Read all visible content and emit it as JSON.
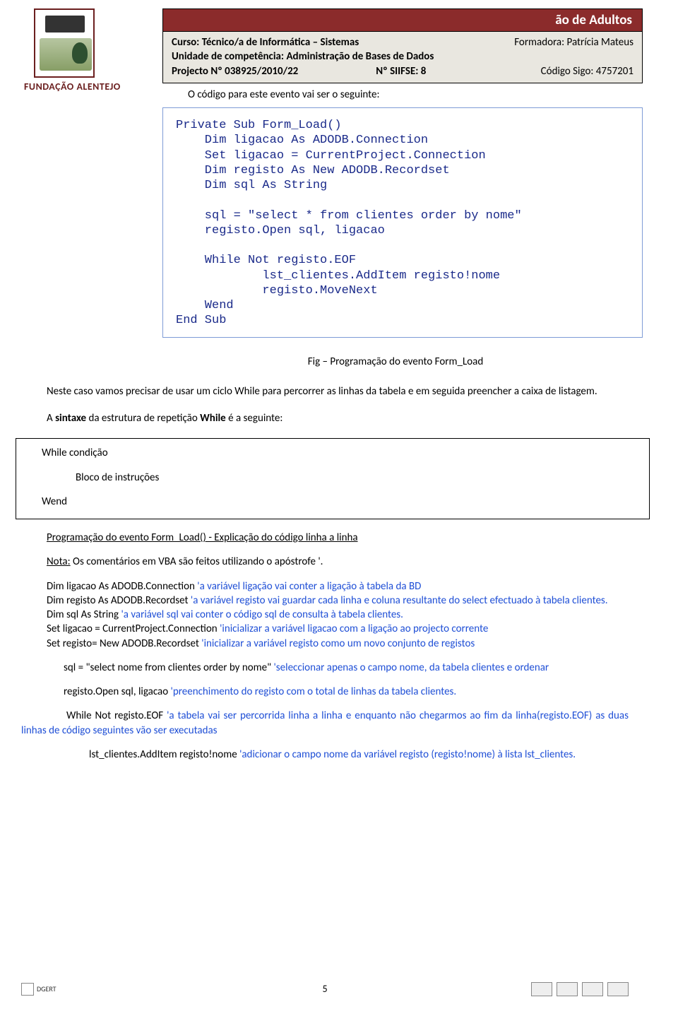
{
  "header": {
    "banner_title": "ão de Adultos",
    "line1_left": "Curso: Técnico/a de Informática – Sistemas",
    "line1_right": "Formadora: Patrícia Mateus",
    "line2_left": "Unidade de competência: Administração de Bases de Dados",
    "line3_left": "Projecto Nº 038925/2010/22",
    "line3_mid": "Nº SIIFSE: 8",
    "line3_right": "Código Sigo: 4757201",
    "logo_text": "FUNDAÇÃO ALENTEJO"
  },
  "intro": "O código para este evento vai ser o seguinte:",
  "code": "Private Sub Form_Load()\n    Dim ligacao As ADODB.Connection\n    Set ligacao = CurrentProject.Connection\n    Dim registo As New ADODB.Recordset\n    Dim sql As String\n\n    sql = \"select * from clientes order by nome\"\n    registo.Open sql, ligacao\n\n    While Not registo.EOF\n            lst_clientes.AddItem registo!nome\n            registo.MoveNext\n    Wend\nEnd Sub",
  "caption": "Fig – Programação do evento Form_Load",
  "p1": "Neste caso vamos precisar de usar um ciclo While para percorrer as linhas da tabela e em seguida preencher a caixa de listagem.",
  "p2_a": "A ",
  "p2_b": "sintaxe",
  "p2_c": " da estrutura de repetição ",
  "p2_d": "While",
  "p2_e": " é a seguinte:",
  "while_cond": "While condição",
  "while_bloco": "Bloco de instruções",
  "while_wend": "Wend",
  "sub_title": "Programação do evento Form_Load() - Explicação do código linha a linha",
  "nota_u": "Nota:",
  "nota_rest": " Os comentários em VBA são feitos utilizando o apóstrofe '.",
  "l1a": "Dim ligacao As ADODB.Connection ",
  "l1b": "'a variável ligação vai conter a ligação à tabela da BD",
  "l2a": "Dim registo As ADODB.Recordset ",
  "l2b": "'a variável registo vai guardar cada linha e coluna resultante do select efectuado à tabela clientes.",
  "l3a": "Dim sql As String ",
  "l3b": "'a variável sql vai conter o código sql de consulta à tabela clientes.",
  "l4a": "Set ligacao = CurrentProject.Connection ",
  "l4b": "'inicializar a variável ligacao com a ligação ao projecto corrente",
  "l5a": "Set registo= New ADODB.Recordset   ",
  "l5b": "'inicializar a variável registo como um novo conjunto de registos",
  "l6a": "sql = \"select nome from clientes order by nome\" ",
  "l6b": "'seleccionar apenas o campo nome, da tabela clientes e ordenar",
  "l7a": "registo.Open sql, ligacao ",
  "l7b": "'preenchimento do registo com o total de linhas da tabela clientes.",
  "l8a": "While Not registo.EOF ",
  "l8b": "'a tabela vai ser percorrida linha a linha e enquanto não chegarmos ao fim da linha(registo.EOF) as duas linhas de código seguintes vão ser executadas",
  "l9a": "lst_clientes.AddItem registo!nome ",
  "l9b": "'adicionar o campo nome da variável registo (registo!nome) à lista lst_clientes.",
  "page_num": "5",
  "footer_left": "DGERT"
}
